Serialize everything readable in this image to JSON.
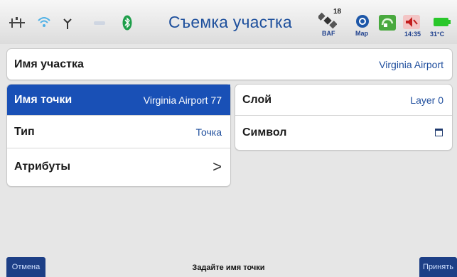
{
  "header": {
    "title": "Съемка участка",
    "satellite_count": "18",
    "fix_label": "BAF",
    "map_label": "Map",
    "time": "14:35",
    "temperature": "31°C"
  },
  "icons": [
    "network-icon",
    "wifi-icon",
    "antenna-icon",
    "bluetooth-icon",
    "satellite-icon",
    "map-icon",
    "app-icon",
    "volume-icon",
    "battery-icon",
    "chevron-right-icon",
    "square-symbol-icon"
  ],
  "area": {
    "label": "Имя участка",
    "value": "Virginia Airport"
  },
  "left_panel": {
    "point_name": {
      "label": "Имя точки",
      "value": "Virginia Airport 77"
    },
    "type": {
      "label": "Тип",
      "value": "Точка"
    },
    "attributes": {
      "label": "Атрибуты",
      "chevron": ">"
    }
  },
  "right_panel": {
    "layer": {
      "label": "Слой",
      "value": "Layer 0"
    },
    "symbol": {
      "label": "Символ"
    }
  },
  "footer": {
    "cancel_label": "Отмена",
    "hint": "Задайте имя точки",
    "accept_label": "Принять"
  },
  "colors": {
    "accent": "#1950b6",
    "title": "#1d4f9c",
    "value_text": "#1f4e9d",
    "button": "#1d3f86"
  }
}
